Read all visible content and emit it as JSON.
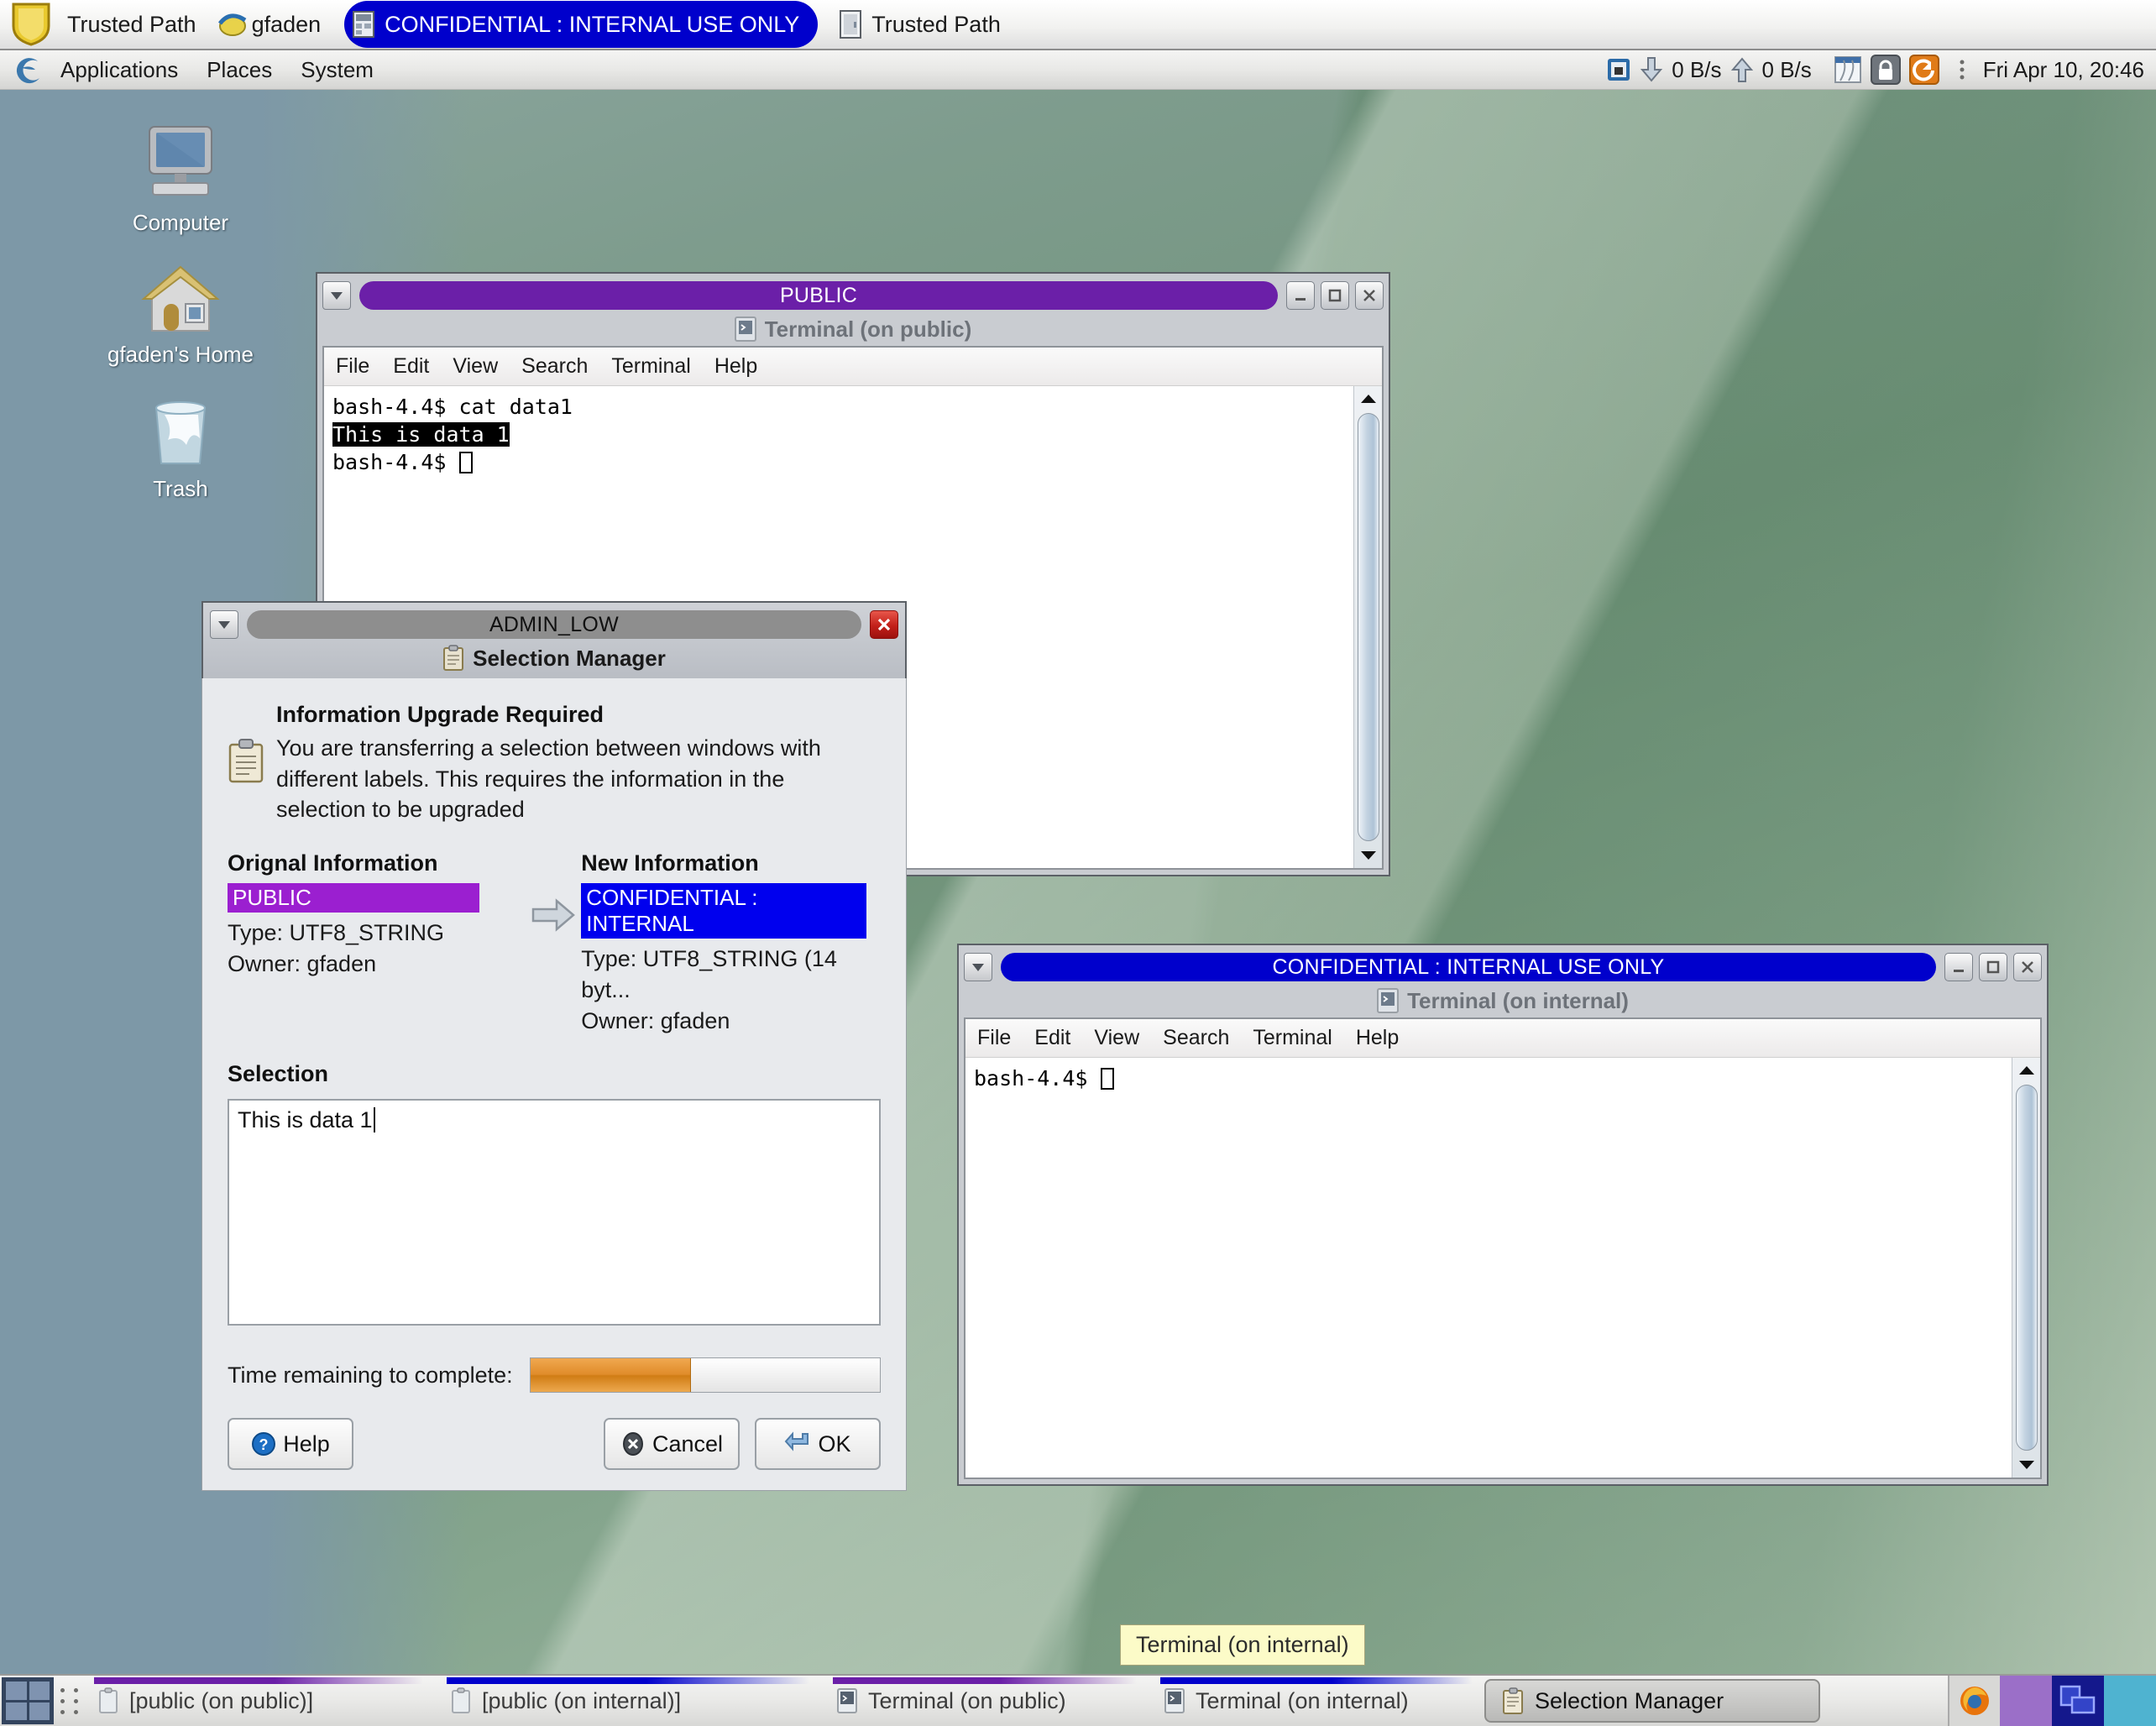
{
  "trusted_path": {
    "shield_icon": "shield-icon",
    "label": "Trusted Path",
    "user_icon": "user-icon",
    "user": "gfaden",
    "window_chip_icon": "window-icon",
    "window_chip_label": "CONFIDENTIAL : INTERNAL USE ONLY",
    "window_chip_color": "#0000cc",
    "right_icon": "window-icon",
    "right_label": "Trusted Path"
  },
  "panel": {
    "logo_icon": "gnome-foot-icon",
    "menus": [
      "Applications",
      "Places",
      "System"
    ],
    "tray": {
      "monitor_icon": "display-icon",
      "download_icon": "arrow-down-icon",
      "download_rate": "0 B/s",
      "upload_icon": "arrow-up-icon",
      "upload_rate": "0 B/s",
      "workspace_icon": "workspace-switch-icon",
      "lock_icon": "lock-icon",
      "logout_icon": "logout-icon",
      "grip_icon": "grip-icon"
    },
    "clock": "Fri Apr 10, 20:46"
  },
  "desktop_icons": [
    {
      "icon": "computer-icon",
      "label": "Computer"
    },
    {
      "icon": "home-folder-icon",
      "label": "gfaden's Home"
    },
    {
      "icon": "trash-icon",
      "label": "Trash"
    }
  ],
  "public_terminal": {
    "classification": "PUBLIC",
    "classification_color": "#6b1fa8",
    "app_icon": "terminal-icon",
    "app_title": "Terminal (on public)",
    "menu": [
      "File",
      "Edit",
      "View",
      "Search",
      "Terminal",
      "Help"
    ],
    "lines": [
      {
        "text": "bash-4.4$ cat data1",
        "inverted": false
      },
      {
        "text": "This is data 1",
        "inverted": true
      },
      {
        "text": "bash-4.4$ ",
        "inverted": false,
        "cursor": true
      }
    ],
    "window_buttons": [
      "minimize",
      "maximize",
      "close"
    ]
  },
  "internal_terminal": {
    "classification": "CONFIDENTIAL : INTERNAL USE ONLY",
    "classification_color": "#0000cc",
    "app_icon": "terminal-icon",
    "app_title": "Terminal (on internal)",
    "menu": [
      "File",
      "Edit",
      "View",
      "Search",
      "Terminal",
      "Help"
    ],
    "lines": [
      {
        "text": "bash-4.4$ ",
        "inverted": false,
        "cursor": true
      }
    ],
    "window_buttons": [
      "minimize",
      "maximize",
      "close"
    ]
  },
  "selection_manager": {
    "classification": "ADMIN_LOW",
    "classification_color": "#8e8e8e",
    "app_icon": "clipboard-icon",
    "app_title": "Selection Manager",
    "close_button": "close",
    "alert_icon": "clipboard-icon",
    "heading": "Information Upgrade Required",
    "body": "You are transferring a selection between windows with different labels.  This requires the information in the selection to be upgraded",
    "original": {
      "heading": "Orignal Information",
      "label": "PUBLIC",
      "label_color": "#9b1fd0",
      "type": "Type: UTF8_STRING",
      "owner": "Owner: gfaden"
    },
    "arrow_icon": "arrow-right-icon",
    "new": {
      "heading": "New Information",
      "label": "CONFIDENTIAL : INTERNAL",
      "label_color": "#0000ee",
      "type": "Type: UTF8_STRING (14 byt...",
      "owner": "Owner: gfaden"
    },
    "selection_heading": "Selection",
    "selection_value": "This is data 1",
    "progress_label": "Time remaining to complete:",
    "progress_percent": 46,
    "progress_color": "#e08c2a",
    "buttons": [
      {
        "label": "Help",
        "icon": "help-icon"
      },
      {
        "label": "Cancel",
        "icon": "cancel-icon"
      },
      {
        "label": "OK",
        "icon": "enter-icon"
      }
    ]
  },
  "tooltip": {
    "text": "Terminal (on internal)"
  },
  "taskbar": {
    "pager_icon": "workspace-pager-icon",
    "items": [
      {
        "icon": "clipboard-icon",
        "label": "[public (on public)]",
        "stripe": "#6b1fa8",
        "active": false
      },
      {
        "icon": "clipboard-icon",
        "label": "[public (on internal)]",
        "stripe": "#0000cc",
        "active": false
      },
      {
        "icon": "terminal-icon",
        "label": "Terminal (on public)",
        "stripe": "#6b1fa8",
        "active": false
      },
      {
        "icon": "terminal-icon",
        "label": "Terminal (on internal)",
        "stripe": "#0000cc",
        "active": false
      },
      {
        "icon": "clipboard-icon",
        "label": "Selection Manager",
        "stripe": "",
        "active": true
      }
    ],
    "tray": [
      {
        "icon": "firefox-icon",
        "color": "#d8d8d6"
      },
      {
        "icon": "swatch",
        "color": "#9b6fc8"
      },
      {
        "icon": "windows-icon",
        "color": "#14188c"
      },
      {
        "icon": "swatch",
        "color": "#4fb3d0"
      }
    ]
  }
}
